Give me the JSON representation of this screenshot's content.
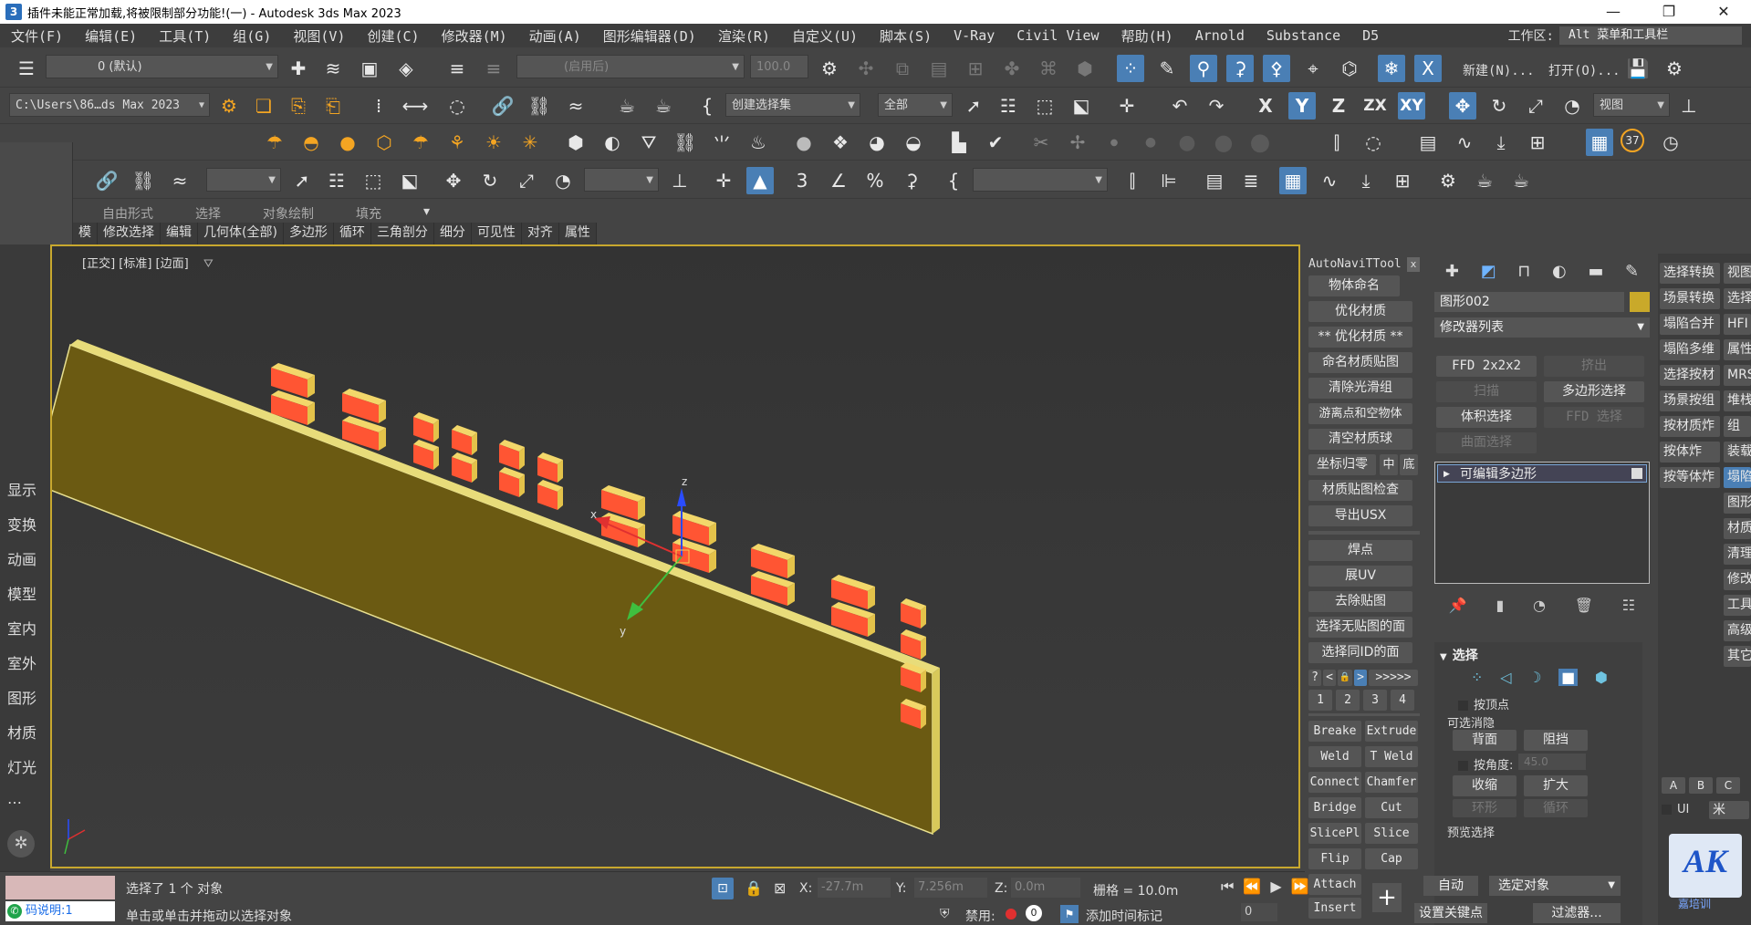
{
  "title": {
    "app_icon": "3",
    "text": "插件未能正常加载,将被限制部分功能!(一) - Autodesk 3ds Max 2023",
    "minimize": "—",
    "maximize": "❐",
    "close": "✕"
  },
  "menu": [
    "文件(F)",
    "编辑(E)",
    "工具(T)",
    "组(G)",
    "视图(V)",
    "创建(C)",
    "修改器(M)",
    "动画(A)",
    "图形编辑器(D)",
    "渲染(R)",
    "自定义(U)",
    "脚本(S)",
    "V-Ray",
    "Civil View",
    "帮助(H)",
    "Arnold",
    "Substance",
    "D5"
  ],
  "workspace": {
    "label": "工作区:",
    "value": "Alt 菜单和工具栏"
  },
  "toolbar1": {
    "layer_value": "0 (默认)",
    "usage_placeholder": "(启用后)",
    "percent": "100.0",
    "new_label": "新建(N)...",
    "open_label": "打开(O)..."
  },
  "toolbar2": {
    "path": "C:\\Users\\86…ds Max 2023",
    "selection_set": "创建选择集",
    "filter": "全部",
    "view": "视图",
    "axis_x": "X",
    "axis_y": "Y",
    "axis_z": "Z",
    "axis_zx": "ZX",
    "axis_xy": "XY"
  },
  "toolbar3": {
    "badge": "37"
  },
  "ribbon": {
    "tabs1": [
      "自由形式",
      "选择",
      "对象绘制",
      "填充"
    ],
    "tabs2": [
      "模",
      "修改选择",
      "编辑",
      "几何体(全部)",
      "多边形",
      "循环",
      "三角剖分",
      "细分",
      "可见性",
      "对齐",
      "属性"
    ]
  },
  "left_sidebar": [
    "显示",
    "变换",
    "动画",
    "模型",
    "室内",
    "室外",
    "图形",
    "材质",
    "灯光",
    "…"
  ],
  "viewport": {
    "label": "[正交] [标准] [边面]",
    "axis_x": "x",
    "axis_y": "y",
    "axis_z": "z"
  },
  "tool_column": {
    "header": "AutoNaviTTool",
    "close": "x",
    "buttons": [
      "物体命名",
      "优化材质",
      "** 优化材质 **",
      "命名材质贴图",
      "清除光滑组",
      "游离点和空物体",
      "清空材质球",
      "坐标归零",
      "材质贴图检查",
      "导出USX",
      "焊点",
      "展UV",
      "去除贴图",
      "选择无贴图的面",
      "选择同ID的面"
    ],
    "coord_extra": [
      "中",
      "底"
    ],
    "nav": [
      "?",
      "<",
      "🔒",
      ">",
      ">>>>>"
    ],
    "nums": [
      "1",
      "2",
      "3",
      "4"
    ],
    "poly": [
      [
        "Breake",
        "Extrude"
      ],
      [
        "Weld",
        "T Weld"
      ],
      [
        "Connect",
        "Chamfer"
      ],
      [
        "Bridge",
        "Cut"
      ],
      [
        "SlicePl",
        "Slice"
      ],
      [
        "Flip",
        "Cap"
      ],
      [
        "Attach",
        ""
      ],
      [
        "Insert",
        ""
      ]
    ]
  },
  "command_panel": {
    "object_name": "图形002",
    "modifier_list": "修改器列表",
    "modifiers": [
      [
        "FFD 2x2x2",
        "挤出"
      ],
      [
        "扫描",
        "多边形选择"
      ],
      [
        "体积选择",
        "FFD 选择"
      ],
      [
        "曲面选择",
        ""
      ]
    ],
    "stack_item": "可编辑多边形",
    "section_select": "选择",
    "by_vertex": "按顶点",
    "backface_group": "可选消隐",
    "backface": "背面",
    "occluded": "阻挡",
    "by_angle": "按角度:",
    "angle_value": "45.0",
    "shrink": "收缩",
    "grow": "扩大",
    "ring": "环形",
    "loop": "循环",
    "preview": "预览选择"
  },
  "far_right": {
    "col1": [
      "选择转换",
      "场景转换",
      "塌陷合并",
      "塌陷多维",
      "选择按材",
      "场景按组",
      "按材质炸",
      "按体炸",
      "按等体炸"
    ],
    "col2": [
      "视图",
      "选择",
      "HFI",
      "属性",
      "MRS",
      "堆栈",
      "组",
      "装载",
      "塌陷",
      "图形",
      "材质",
      "清理",
      "修改",
      "工具",
      "高级",
      "其它"
    ],
    "abc": [
      "A",
      "B",
      "C"
    ],
    "ui": "UI",
    "unit": "米",
    "logo": "AK",
    "logo_sub": "嘉培训"
  },
  "status": {
    "selected": "选择了 1 个 对象",
    "prompt": "单击或单击并拖动以选择对象",
    "script_label": "码说明:1",
    "x_label": "X:",
    "x_value": "-27.7m",
    "y_label": "Y:",
    "y_value": "7.256m",
    "z_label": "Z:",
    "z_value": "0.0m",
    "grid": "栅格 = 10.0m",
    "disabled": "禁用:",
    "disabled_value": "0",
    "add_time_tag": "添加时间标记",
    "auto": "自动",
    "selected_object": "选定对象",
    "set_keypoint": "设置关键点",
    "filter": "过滤器...",
    "frame": "0"
  },
  "colors": {
    "accent_blue": "#4a7fb5",
    "viewport_border": "#c8a82e",
    "wall": "#6b5a12",
    "brick": "#ff5533",
    "brick_top": "#f2d76a",
    "swatch": "#c9a92a"
  }
}
